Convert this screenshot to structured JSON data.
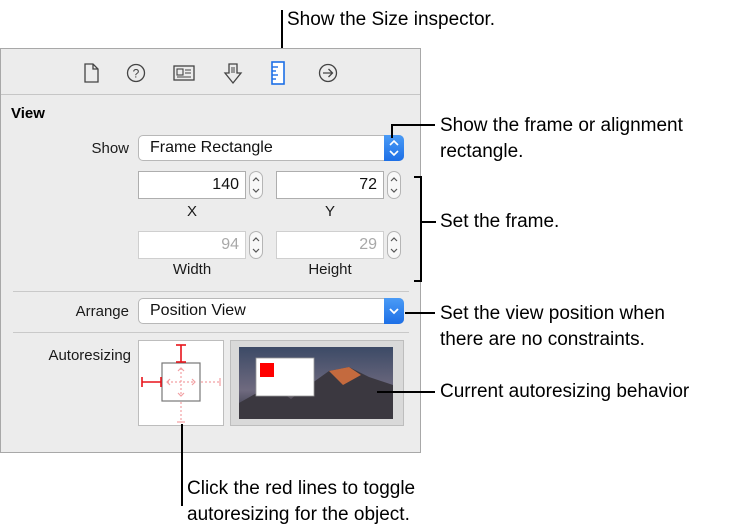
{
  "toolbar": {
    "icons": [
      "file-icon",
      "help-icon",
      "identity-icon",
      "attributes-icon",
      "size-icon",
      "connections-icon"
    ],
    "selected_icon": "size-icon"
  },
  "section_title": "View",
  "show": {
    "label": "Show",
    "value": "Frame Rectangle"
  },
  "frame": {
    "x_value": "140",
    "y_value": "72",
    "x_label": "X",
    "y_label": "Y",
    "width_value": "94",
    "height_value": "29",
    "width_label": "Width",
    "height_label": "Height"
  },
  "arrange": {
    "label": "Arrange",
    "value": "Position View"
  },
  "autoresizing": {
    "label": "Autoresizing"
  },
  "callouts": {
    "size_inspector": "Show the Size inspector.",
    "frame_or_alignment_line1": "Show the frame or alignment",
    "frame_or_alignment_line2": "rectangle.",
    "set_frame": "Set the frame.",
    "view_position_line1": "Set the view position when",
    "view_position_line2": "there are no constraints.",
    "current_behavior": "Current autoresizing behavior",
    "click_red_line1": "Click the red lines to toggle",
    "click_red_line2": "autoresizing for the object."
  },
  "colors": {
    "accent": "#1d6fe6",
    "strut": "#e8141b",
    "panel": "#ececec"
  }
}
